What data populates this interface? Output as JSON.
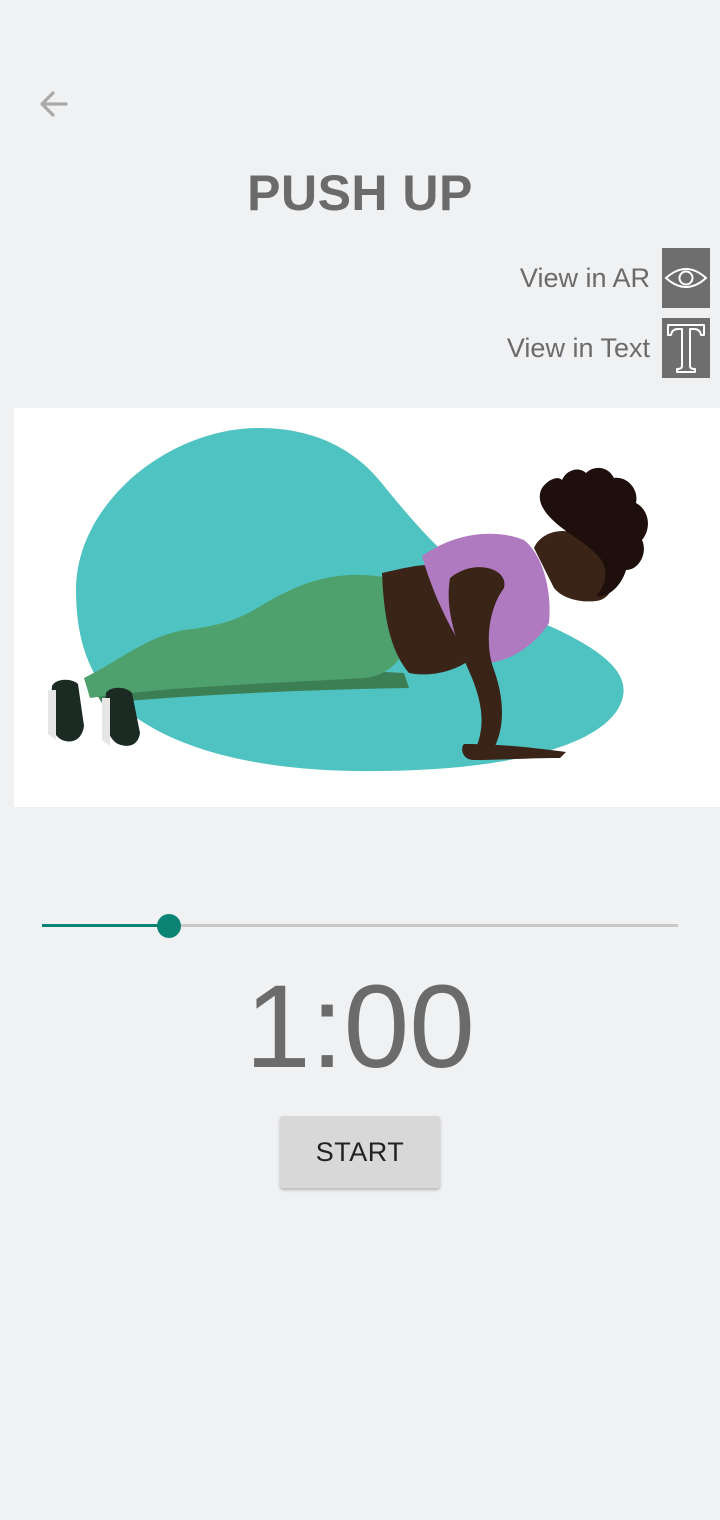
{
  "header": {
    "back_icon": "arrow-left-icon",
    "title": "PUSH UP"
  },
  "views": {
    "ar_label": "View in AR",
    "ar_icon": "eye-icon",
    "text_label": "View in Text",
    "text_icon": "letter-t-icon"
  },
  "timer": {
    "slider_progress": 0.2,
    "time": "1:00",
    "start_label": "START"
  },
  "colors": {
    "accent": "#0b8375",
    "blob": "#4fc3c1",
    "legging": "#4ea06c",
    "top": "#b07ac0",
    "skin": "#3a2418"
  }
}
